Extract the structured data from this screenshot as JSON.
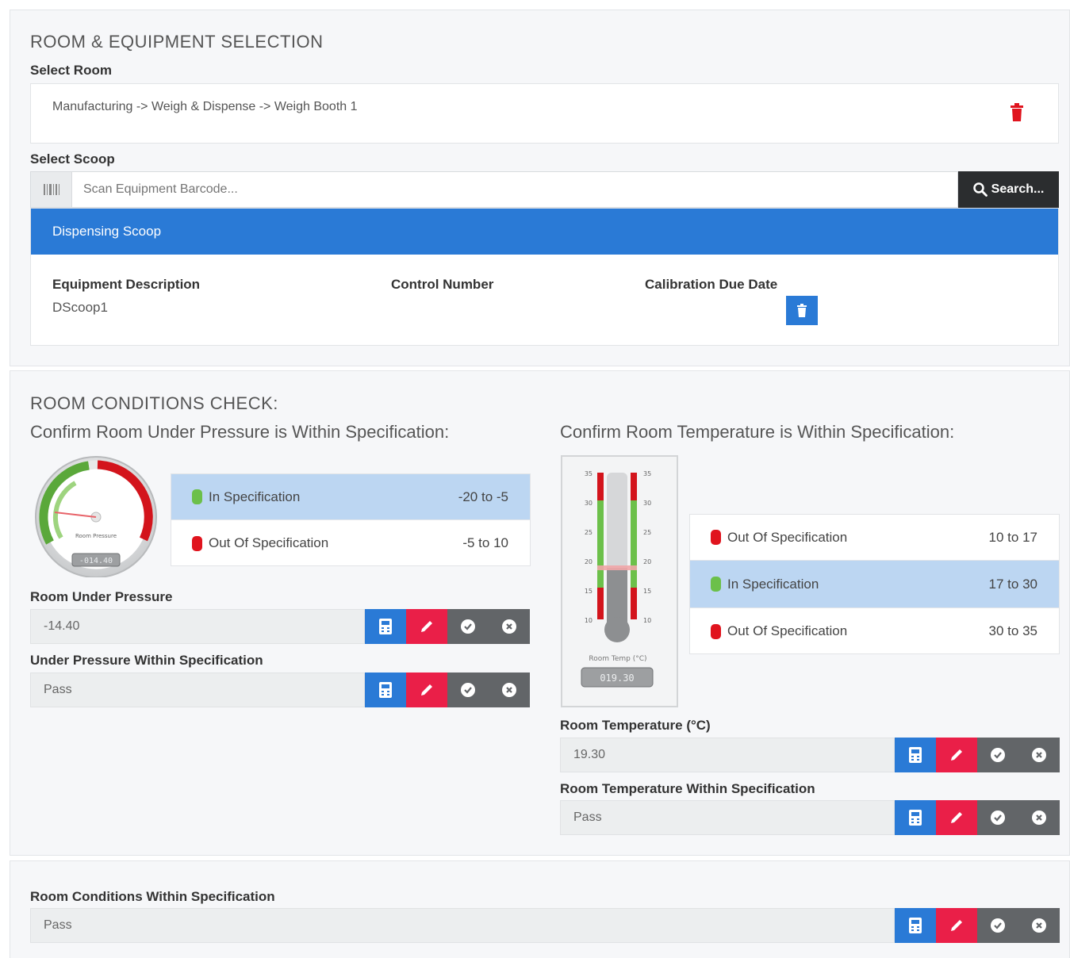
{
  "equipment_section": {
    "heading": "ROOM & EQUIPMENT SELECTION",
    "select_room_label": "Select Room",
    "room_path": "Manufacturing -> Weigh & Dispense -> Weigh Booth 1",
    "select_scoop_label": "Select Scoop",
    "scan_placeholder": "Scan Equipment Barcode...",
    "search_label": "Search...",
    "scoop_title": "Dispensing Scoop",
    "columns": {
      "description": "Equipment Description",
      "control_number": "Control Number",
      "calibration_due": "Calibration Due Date"
    },
    "description_value": "DScoop1"
  },
  "conditions_section": {
    "heading": "ROOM CONDITIONS CHECK:",
    "pressure_heading": "Confirm Room Under Pressure is Within Specification:",
    "temperature_heading": "Confirm Room Temperature is Within Specification:",
    "pressure_gauge": {
      "title": "Room Pressure",
      "readout": "-014.40",
      "value": -14.4
    },
    "pressure_specs": [
      {
        "label": "In Specification",
        "range": "-20 to -5",
        "color": "#6cc04a",
        "active": true
      },
      {
        "label": "Out Of Specification",
        "range": "-5 to 10",
        "color": "#e0141e",
        "active": false
      }
    ],
    "room_under_pressure_label": "Room Under Pressure",
    "room_under_pressure_value": "-14.40",
    "under_pressure_spec_label": "Under Pressure Within Specification",
    "under_pressure_spec_value": "Pass",
    "thermometer": {
      "title": "Room Temp (°C)",
      "readout": "019.30",
      "value": 19.3,
      "ticks": [
        "35",
        "30",
        "25",
        "20",
        "15",
        "10"
      ]
    },
    "temperature_specs": [
      {
        "label": "Out Of Specification",
        "range": "10 to 17",
        "color": "#e0141e",
        "active": false
      },
      {
        "label": "In Specification",
        "range": "17 to 30",
        "color": "#6cc04a",
        "active": true
      },
      {
        "label": "Out Of Specification",
        "range": "30 to 35",
        "color": "#e0141e",
        "active": false
      }
    ],
    "room_temperature_label": "Room Temperature (°C)",
    "room_temperature_value": "19.30",
    "temperature_spec_label": "Room Temperature Within Specification",
    "temperature_spec_value": "Pass"
  },
  "summary_section": {
    "label": "Room Conditions Within Specification",
    "value": "Pass"
  }
}
